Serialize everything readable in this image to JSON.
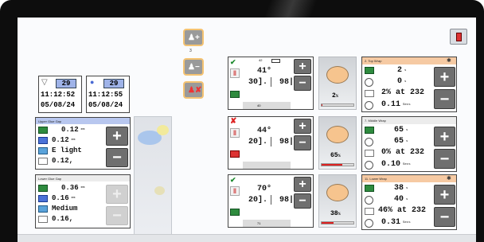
{
  "top_left": {
    "filter_counter": "29",
    "filter_time": "11:12:52",
    "filter_date": "05/08/24",
    "glue_counter": "29",
    "glue_time": "11:12:55",
    "glue_date": "05/08/24"
  },
  "upper_glue": {
    "title": "Upper Glue Gap",
    "gap": "0.12",
    "gap_unit": "mm",
    "tolerance": "0.12",
    "tolerance_unit": "mm",
    "weight": "E light",
    "last": "0.12,"
  },
  "lower_glue": {
    "title": "Lower Glue Gap",
    "gap": "0.36",
    "gap_unit": "mm",
    "tolerance": "0.16",
    "tolerance_unit": "mm",
    "weight": "Medium",
    "last": "0.16,"
  },
  "mode_buttons": {
    "add_label": "3"
  },
  "stations": [
    {
      "status": "ok",
      "top_num": "42",
      "temp": "41°",
      "setpoint": "30].",
      "speed": "98|'",
      "bottom_num": "40",
      "gauge_value": "2",
      "gauge_unit": "%"
    },
    {
      "status": "error",
      "top_num": "",
      "temp": "44°",
      "setpoint": "20].",
      "speed": "98|'",
      "bottom_num": "",
      "gauge_value": "65",
      "gauge_unit": "%"
    },
    {
      "status": "ok",
      "top_num": "",
      "temp": "70°",
      "setpoint": "20].",
      "speed": "98|'",
      "bottom_num": "71",
      "gauge_value": "38",
      "gauge_unit": "%"
    }
  ],
  "wraps": [
    {
      "title": "2. Top Wrap",
      "header_color": "#f6caa3",
      "value1": "2",
      "unit1": "s",
      "value2": "0",
      "unit2": "s",
      "ratio": "2% at 232",
      "time": "0.11",
      "time_unit": "Secs"
    },
    {
      "title": "7. Middle Wrap",
      "header_color": "#ececec",
      "value1": "65",
      "unit1": "s",
      "value2": "65",
      "unit2": "s",
      "ratio": "0% at 232",
      "time": "0.10",
      "time_unit": "Secs"
    },
    {
      "title": "11. Lower Wrap",
      "header_color": "#f6caa3",
      "value1": "38",
      "unit1": "s",
      "value2": "40",
      "unit2": "s",
      "ratio": "46% at 232",
      "time": "0.31",
      "time_unit": "Secs"
    }
  ],
  "glyphs": {
    "plus": "+",
    "minus": "−",
    "check": "✔",
    "cross": "✘",
    "filter": "⏷"
  }
}
